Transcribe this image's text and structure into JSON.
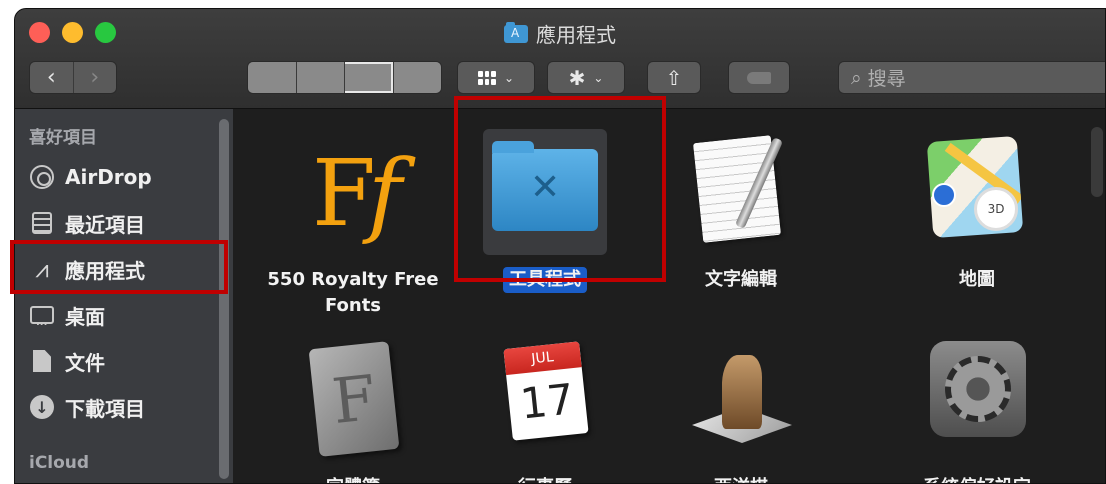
{
  "window": {
    "title": "應用程式",
    "title_icon": "applications-folder-icon"
  },
  "toolbar": {
    "back_glyph": "‹",
    "forward_glyph": "›",
    "group_chevron": "⌄",
    "action_glyph": "✱",
    "action_chevron": "⌄",
    "share_glyph": "⇧",
    "search_placeholder": "搜尋",
    "search_glyph": "⌕"
  },
  "sidebar": {
    "favorites_heading": "喜好項目",
    "items": [
      {
        "label": "AirDrop",
        "icon": "airdrop-icon"
      },
      {
        "label": "最近項目",
        "icon": "recents-icon"
      },
      {
        "label": "應用程式",
        "icon": "applications-icon"
      },
      {
        "label": "桌面",
        "icon": "desktop-icon"
      },
      {
        "label": "文件",
        "icon": "documents-icon"
      },
      {
        "label": "下載項目",
        "icon": "downloads-icon"
      }
    ],
    "icloud_heading": "iCloud",
    "apps_glyph": "⩘",
    "downloads_glyph": "↓"
  },
  "apps": [
    {
      "label": "550 Royalty Free Fonts",
      "line1": "550 Royalty Free",
      "line2": "Fonts",
      "icon": "fonts-ff-icon",
      "glyph_f": "F",
      "glyph_f2": "f"
    },
    {
      "label": "工具程式",
      "icon": "utilities-folder-icon",
      "selected": true
    },
    {
      "label": "文字編輯",
      "icon": "textedit-icon"
    },
    {
      "label": "地圖",
      "icon": "maps-icon",
      "badge": "3D"
    },
    {
      "label": "字體簿",
      "icon": "fontbook-icon",
      "glyph": "F"
    },
    {
      "label": "行事曆",
      "icon": "calendar-icon",
      "month": "JUL",
      "day": "17"
    },
    {
      "label": "西洋棋",
      "icon": "chess-icon"
    },
    {
      "label": "系統偏好設定",
      "icon": "system-preferences-icon"
    }
  ],
  "colors": {
    "highlight_box": "#c00000",
    "selection": "#1a5dc8",
    "window_bg": "#1e1e1e",
    "sidebar_bg": "#3a3c40"
  }
}
